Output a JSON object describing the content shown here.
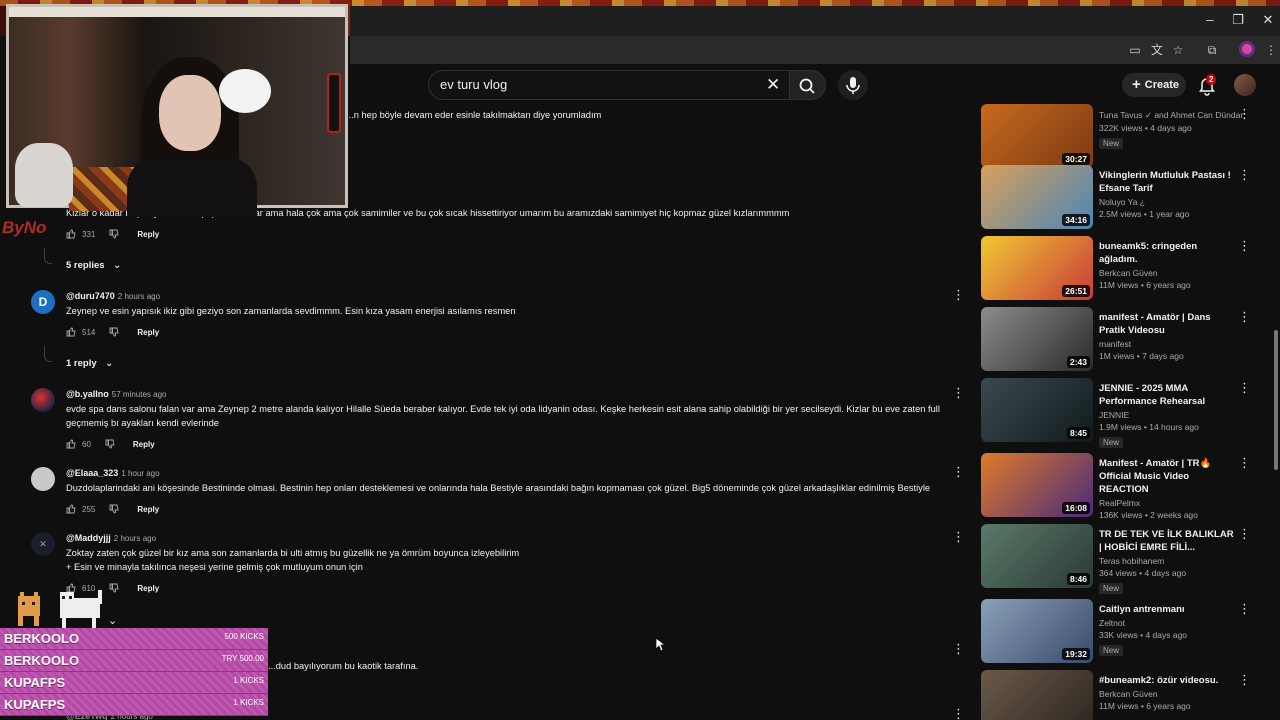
{
  "header": {
    "search_query": "ev turu vlog",
    "create_label": "Create",
    "notification_count": "2"
  },
  "comments": [
    {
      "author": "",
      "time": "",
      "text": "...n hep böyle devam eder esinle takılmaktan diye yorumladım",
      "likes": "",
      "reply_label": ""
    },
    {
      "author": "",
      "time": "",
      "text": "Kizlar o kadar başarı yakaladılar popüler oldular ama hala çok ama çok samimiler ve bu çok sıcak hissettiriyor umarım bu aramızdaki samimiyet hiç kopmaz güzel kızlarımmmm",
      "likes": "331",
      "reply_label": "Reply",
      "replies_toggle": "5 replies"
    },
    {
      "author": "@duru7470",
      "time": "2 hours ago",
      "avatar_letter": "D",
      "text": "Zeynep ve esin yapısık ikiz gibi geziyo son zamanlarda sevdimmm. Esin kıza yasam enerjisi asılamıs resmen",
      "likes": "514",
      "reply_label": "Reply",
      "replies_toggle": "1 reply"
    },
    {
      "author": "@b.yallno",
      "time": "57 minutes ago",
      "text1": "evde spa dans salonu falan var ama Zeynep 2 metre alanda kalıyor Hilalle Süeda beraber kalıyor. Evde tek iyi oda lidyanin odası. Keşke herkesin esit alana sahip olabildiği bir yer secilseydi. Kizlar bu eve zaten full",
      "text2": "geçmemiş bı ayakları kendi evlerinde",
      "likes": "60",
      "reply_label": "Reply"
    },
    {
      "author": "@Elaaa_323",
      "time": "1 hour ago",
      "text": "Duzdolaplarindaki ani köşesinde Bestininde olmasi. Bestinin hep onları desteklemesi ve onlarında hala Bestiyle arasındaki bağın kopmaması çok güzel. Big5 döneminde çok güzel arkadaşlıklar edinilmiş Bestiyle",
      "likes": "255",
      "reply_label": "Reply"
    },
    {
      "author": "@Maddyjjj",
      "time": "2 hours ago",
      "text1": "Zoktay zaten çok güzel bir kız ama son zamanlarda bi ulti atmış bu güzellik ne ya ömrüm boyunca izleyebilirim",
      "text2": "+ Esin ve minayla takılınca neşesi yerine gelmiş çok mutluyum onun için",
      "likes": "610",
      "reply_label": "Reply"
    },
    {
      "author": "",
      "time": "",
      "text": "...dud bayılıyorum bu kaotik tarafına.",
      "likes": "",
      "reply_label": "Reply"
    },
    {
      "author": "@EzeTwq",
      "time": "2 hours ago"
    }
  ],
  "recommendations": [
    {
      "title": "",
      "channel": "Tuna Tavus ✓ and Ahmet Can Dündar",
      "meta": "322K views • 4 days ago",
      "new": "New",
      "duration": "30:27",
      "colors": [
        "#c96a1e",
        "#7a3a12"
      ]
    },
    {
      "title": "Vikinglerin Mutluluk Pastası ! Efsane Tarif",
      "channel": "Noluyo Ya ¿",
      "meta": "2.5M views • 1 year ago",
      "new": "",
      "duration": "34:16",
      "colors": [
        "#d9a05a",
        "#4a86b8"
      ]
    },
    {
      "title": "buneamk5: cringeden ağladım.",
      "channel": "Berkcan Güven",
      "meta": "11M views • 6 years ago",
      "new": "",
      "duration": "26:51",
      "colors": [
        "#f0c833",
        "#c83a3a"
      ]
    },
    {
      "title": "manifest - Amatör | Dans Pratik Videosu",
      "channel": "manifest",
      "meta": "1M views • 7 days ago",
      "new": "",
      "duration": "2:43",
      "colors": [
        "#8c8c8c",
        "#2a2a2a"
      ]
    },
    {
      "title": "JENNIE - 2025 MMA Performance Rehearsal",
      "channel": "JENNIE",
      "meta": "1.9M views • 14 hours ago",
      "new": "New",
      "duration": "8:45",
      "colors": [
        "#3a4a50",
        "#111a1c"
      ]
    },
    {
      "title": "Manifest - Amatör | TR🔥 Official Music Video REACTION",
      "channel": "RealPelmx",
      "meta": "136K views • 2 weeks ago",
      "new": "",
      "duration": "16:08",
      "colors": [
        "#e07a2a",
        "#4a2a7a"
      ]
    },
    {
      "title": "TR DE TEK VE İLK BALIKLAR | HOBİCİ EMRE FİLİ...",
      "channel": "Teras hobihanem",
      "meta": "364 views • 4 days ago",
      "new": "New",
      "duration": "8:46",
      "colors": [
        "#5a7a6a",
        "#2a3a34"
      ]
    },
    {
      "title": "Caitlyn antrenmanı",
      "channel": "Zeltnot",
      "meta": "33K views • 4 days ago",
      "new": "New",
      "duration": "19:32",
      "colors": [
        "#8aa0b8",
        "#3a4a6a"
      ]
    },
    {
      "title": "#buneamk2: özür videosu.",
      "channel": "Berkcan Güven",
      "meta": "11M views • 6 years ago",
      "new": "",
      "duration": "",
      "colors": [
        "#6a5a4a",
        "#2a2420"
      ]
    }
  ],
  "overlay": {
    "logo_text": "ByNo",
    "kicks": [
      {
        "name": "BERKOOLO",
        "amount": "500 KICKS"
      },
      {
        "name": "BERKOOLO",
        "amount": "TRY 500.00"
      },
      {
        "name": "KUPAFPS",
        "amount": "1 KICKS"
      },
      {
        "name": "KUPAFPS",
        "amount": "1 KICKS"
      }
    ]
  }
}
